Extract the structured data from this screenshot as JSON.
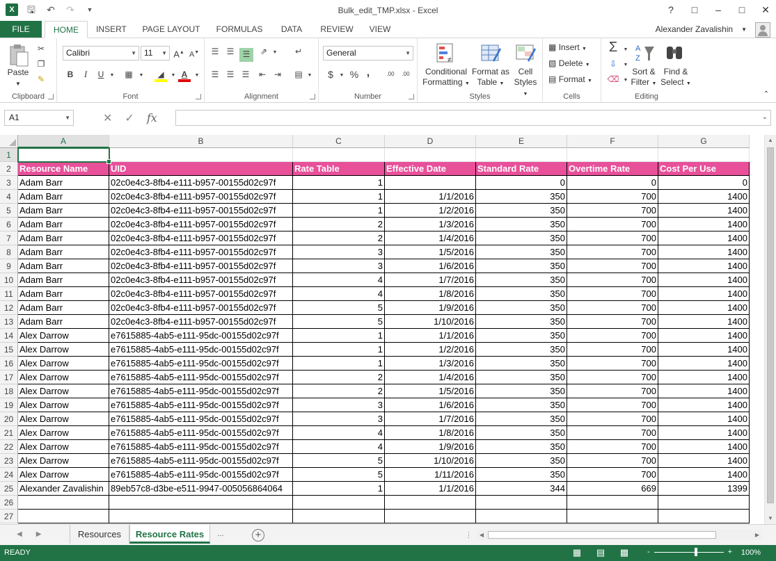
{
  "window": {
    "title": "Bulk_edit_TMP.xlsx - Excel",
    "help": "?",
    "app_logo": "X"
  },
  "tabs": [
    "FILE",
    "HOME",
    "INSERT",
    "PAGE LAYOUT",
    "FORMULAS",
    "DATA",
    "REVIEW",
    "VIEW"
  ],
  "active_tab": "HOME",
  "user": {
    "name": "Alexander Zavalishin"
  },
  "ribbon": {
    "clipboard": {
      "label": "Clipboard",
      "paste": "Paste"
    },
    "font": {
      "label": "Font",
      "name": "Calibri",
      "size": "11",
      "bold": "B",
      "italic": "I",
      "underline": "U",
      "grow": "A",
      "shrink": "A"
    },
    "alignment": {
      "label": "Alignment"
    },
    "number": {
      "label": "Number",
      "format": "General",
      "currency": "$",
      "percent": "%",
      "comma": ",",
      "inc_decimal": ".00",
      "dec_decimal": ".00"
    },
    "styles": {
      "label": "Styles",
      "conditional": [
        "Conditional",
        "Formatting"
      ],
      "format_table": [
        "Format as",
        "Table"
      ],
      "cell_styles": [
        "Cell",
        "Styles"
      ]
    },
    "cells": {
      "label": "Cells",
      "insert": "Insert",
      "delete": "Delete",
      "format": "Format"
    },
    "editing": {
      "label": "Editing",
      "sort": [
        "Sort &",
        "Filter"
      ],
      "find": [
        "Find &",
        "Select"
      ]
    }
  },
  "formula_bar": {
    "name_box": "A1",
    "fx": "fx",
    "value": ""
  },
  "grid": {
    "columns": [
      "A",
      "B",
      "C",
      "D",
      "E",
      "F",
      "G"
    ],
    "selected_column": "A",
    "selected_row": "1",
    "header": [
      "Resource Name",
      "UID",
      "Rate Table",
      "Effective Date",
      "Standard Rate",
      "Overtime Rate",
      "Cost Per Use"
    ],
    "rows": [
      [
        "Adam Barr",
        "02c0e4c3-8fb4-e111-b957-00155d02c97f",
        "1",
        "",
        "0",
        "0",
        "0"
      ],
      [
        "Adam Barr",
        "02c0e4c3-8fb4-e111-b957-00155d02c97f",
        "1",
        "1/1/2016",
        "350",
        "700",
        "1400"
      ],
      [
        "Adam Barr",
        "02c0e4c3-8fb4-e111-b957-00155d02c97f",
        "1",
        "1/2/2016",
        "350",
        "700",
        "1400"
      ],
      [
        "Adam Barr",
        "02c0e4c3-8fb4-e111-b957-00155d02c97f",
        "2",
        "1/3/2016",
        "350",
        "700",
        "1400"
      ],
      [
        "Adam Barr",
        "02c0e4c3-8fb4-e111-b957-00155d02c97f",
        "2",
        "1/4/2016",
        "350",
        "700",
        "1400"
      ],
      [
        "Adam Barr",
        "02c0e4c3-8fb4-e111-b957-00155d02c97f",
        "3",
        "1/5/2016",
        "350",
        "700",
        "1400"
      ],
      [
        "Adam Barr",
        "02c0e4c3-8fb4-e111-b957-00155d02c97f",
        "3",
        "1/6/2016",
        "350",
        "700",
        "1400"
      ],
      [
        "Adam Barr",
        "02c0e4c3-8fb4-e111-b957-00155d02c97f",
        "4",
        "1/7/2016",
        "350",
        "700",
        "1400"
      ],
      [
        "Adam Barr",
        "02c0e4c3-8fb4-e111-b957-00155d02c97f",
        "4",
        "1/8/2016",
        "350",
        "700",
        "1400"
      ],
      [
        "Adam Barr",
        "02c0e4c3-8fb4-e111-b957-00155d02c97f",
        "5",
        "1/9/2016",
        "350",
        "700",
        "1400"
      ],
      [
        "Adam Barr",
        "02c0e4c3-8fb4-e111-b957-00155d02c97f",
        "5",
        "1/10/2016",
        "350",
        "700",
        "1400"
      ],
      [
        "Alex Darrow",
        "e7615885-4ab5-e111-95dc-00155d02c97f",
        "1",
        "1/1/2016",
        "350",
        "700",
        "1400"
      ],
      [
        "Alex Darrow",
        "e7615885-4ab5-e111-95dc-00155d02c97f",
        "1",
        "1/2/2016",
        "350",
        "700",
        "1400"
      ],
      [
        "Alex Darrow",
        "e7615885-4ab5-e111-95dc-00155d02c97f",
        "1",
        "1/3/2016",
        "350",
        "700",
        "1400"
      ],
      [
        "Alex Darrow",
        "e7615885-4ab5-e111-95dc-00155d02c97f",
        "2",
        "1/4/2016",
        "350",
        "700",
        "1400"
      ],
      [
        "Alex Darrow",
        "e7615885-4ab5-e111-95dc-00155d02c97f",
        "2",
        "1/5/2016",
        "350",
        "700",
        "1400"
      ],
      [
        "Alex Darrow",
        "e7615885-4ab5-e111-95dc-00155d02c97f",
        "3",
        "1/6/2016",
        "350",
        "700",
        "1400"
      ],
      [
        "Alex Darrow",
        "e7615885-4ab5-e111-95dc-00155d02c97f",
        "3",
        "1/7/2016",
        "350",
        "700",
        "1400"
      ],
      [
        "Alex Darrow",
        "e7615885-4ab5-e111-95dc-00155d02c97f",
        "4",
        "1/8/2016",
        "350",
        "700",
        "1400"
      ],
      [
        "Alex Darrow",
        "e7615885-4ab5-e111-95dc-00155d02c97f",
        "4",
        "1/9/2016",
        "350",
        "700",
        "1400"
      ],
      [
        "Alex Darrow",
        "e7615885-4ab5-e111-95dc-00155d02c97f",
        "5",
        "1/10/2016",
        "350",
        "700",
        "1400"
      ],
      [
        "Alex Darrow",
        "e7615885-4ab5-e111-95dc-00155d02c97f",
        "5",
        "1/11/2016",
        "350",
        "700",
        "1400"
      ],
      [
        "Alexander Zavalishin",
        "89eb57c8-d3be-e511-9947-005056864064",
        "1",
        "1/1/2016",
        "344",
        "669",
        "1399"
      ]
    ],
    "row_numbers": [
      "1",
      "2",
      "3",
      "4",
      "5",
      "6",
      "7",
      "8",
      "9",
      "10",
      "11",
      "12",
      "13",
      "14",
      "15",
      "16",
      "17",
      "18",
      "19",
      "20",
      "21",
      "22",
      "23",
      "24",
      "25",
      "26",
      "27"
    ],
    "header_color": "#e8509a"
  },
  "sheets": {
    "tabs": [
      "Resources",
      "Resource Rates"
    ],
    "active": "Resource Rates",
    "ellipsis": "...",
    "add": "+"
  },
  "status": {
    "text": "READY",
    "zoom": "100%",
    "zoom_minus": "-",
    "zoom_plus": "+"
  },
  "colors": {
    "accent": "#217346"
  }
}
